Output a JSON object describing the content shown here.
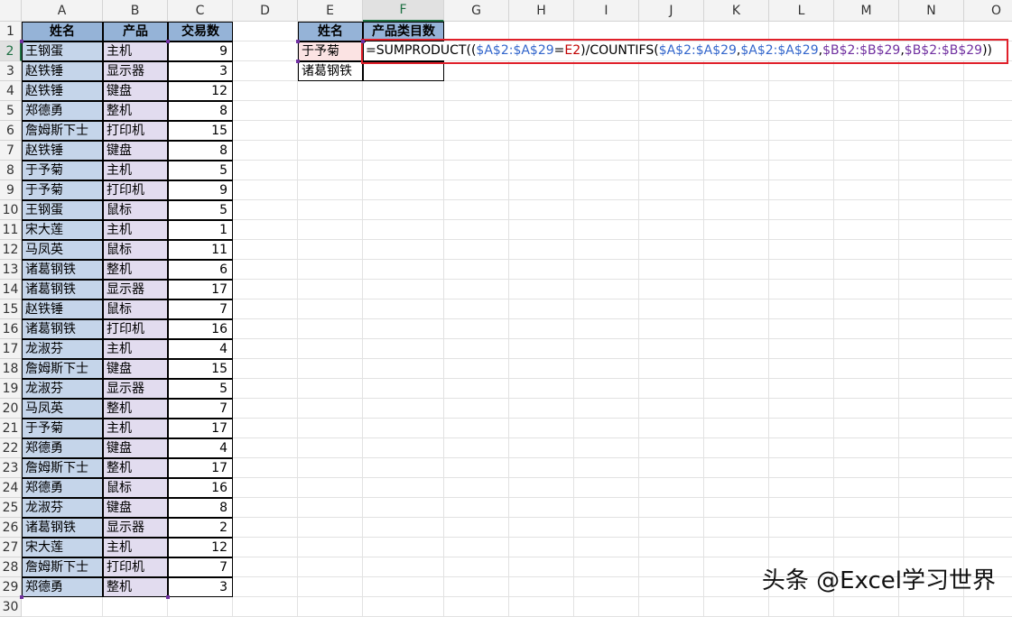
{
  "columns": [
    "A",
    "B",
    "C",
    "D",
    "E",
    "F",
    "G",
    "H",
    "I",
    "J",
    "K",
    "L",
    "M",
    "N",
    "O"
  ],
  "selected_column": "F",
  "selected_row": 2,
  "table": {
    "headers": [
      "姓名",
      "产品",
      "交易数"
    ],
    "rows": [
      [
        "王钢蛋",
        "主机",
        "9"
      ],
      [
        "赵铁锤",
        "显示器",
        "3"
      ],
      [
        "赵铁锤",
        "键盘",
        "12"
      ],
      [
        "郑德勇",
        "整机",
        "8"
      ],
      [
        "詹姆斯下士",
        "打印机",
        "15"
      ],
      [
        "赵铁锤",
        "键盘",
        "8"
      ],
      [
        "于予菊",
        "主机",
        "5"
      ],
      [
        "于予菊",
        "打印机",
        "9"
      ],
      [
        "王钢蛋",
        "鼠标",
        "5"
      ],
      [
        "宋大莲",
        "主机",
        "1"
      ],
      [
        "马凤英",
        "鼠标",
        "11"
      ],
      [
        "诸葛钢铁",
        "整机",
        "6"
      ],
      [
        "诸葛钢铁",
        "显示器",
        "17"
      ],
      [
        "赵铁锤",
        "鼠标",
        "7"
      ],
      [
        "诸葛钢铁",
        "打印机",
        "16"
      ],
      [
        "龙淑芬",
        "主机",
        "4"
      ],
      [
        "詹姆斯下士",
        "键盘",
        "15"
      ],
      [
        "龙淑芬",
        "显示器",
        "5"
      ],
      [
        "马凤英",
        "整机",
        "7"
      ],
      [
        "于予菊",
        "主机",
        "17"
      ],
      [
        "郑德勇",
        "键盘",
        "4"
      ],
      [
        "詹姆斯下士",
        "整机",
        "17"
      ],
      [
        "郑德勇",
        "鼠标",
        "16"
      ],
      [
        "龙淑芬",
        "键盘",
        "8"
      ],
      [
        "诸葛钢铁",
        "显示器",
        "2"
      ],
      [
        "宋大莲",
        "主机",
        "12"
      ],
      [
        "詹姆斯下士",
        "打印机",
        "7"
      ],
      [
        "郑德勇",
        "整机",
        "3"
      ]
    ]
  },
  "lookup": {
    "headers": [
      "姓名",
      "产品类目数"
    ],
    "names": [
      "于予菊",
      "诸葛钢铁"
    ]
  },
  "formula": {
    "parts": [
      {
        "text": "=SUMPRODUCT((",
        "color": "black"
      },
      {
        "text": "$A$2:$A$29",
        "color": "blue"
      },
      {
        "text": "=",
        "color": "black"
      },
      {
        "text": "E2",
        "color": "red"
      },
      {
        "text": ")/COUNTIFS(",
        "color": "black"
      },
      {
        "text": "$A$2:$A$29",
        "color": "blue"
      },
      {
        "text": ",",
        "color": "black"
      },
      {
        "text": "$A$2:$A$29",
        "color": "blue"
      },
      {
        "text": ",",
        "color": "black"
      },
      {
        "text": "$B$2:$B$29",
        "color": "purple"
      },
      {
        "text": ",",
        "color": "black"
      },
      {
        "text": "$B$2:$B$29",
        "color": "purple"
      },
      {
        "text": "))",
        "color": "black"
      }
    ]
  },
  "colors": {
    "header_fill": "#95b3d7",
    "name_fill": "#c5d5ea",
    "product_fill": "#e2dcef",
    "e2_fill": "#fbe3e3",
    "highlight_border": "#e0202a"
  },
  "watermark": "头条 @Excel学习世界"
}
